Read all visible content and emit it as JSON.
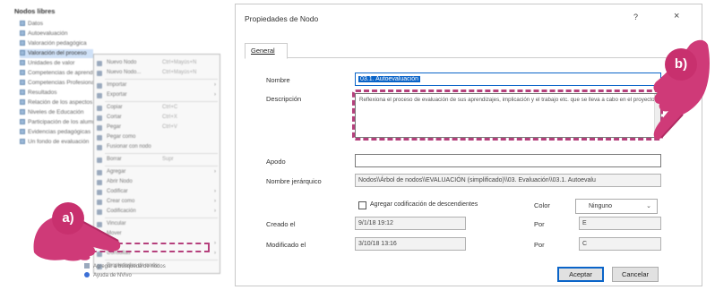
{
  "tree": {
    "title": "Nodos libres",
    "items": [
      {
        "label": "Datos",
        "selected": false
      },
      {
        "label": "Autoevaluación",
        "selected": false
      },
      {
        "label": "Valoración pedagógica",
        "selected": false
      },
      {
        "label": "Valoración del proceso",
        "selected": true
      },
      {
        "label": "Unidades de valor",
        "selected": false
      },
      {
        "label": "Competencias de aprendizaje",
        "selected": false
      },
      {
        "label": "Competencias Profesionales",
        "selected": false
      },
      {
        "label": "Resultados",
        "selected": false
      },
      {
        "label": "Relación de los aspectos",
        "selected": false
      },
      {
        "label": "Niveles de Educación",
        "selected": false
      },
      {
        "label": "Participación de los alumnos",
        "selected": false
      },
      {
        "label": "Evidencias pedagógicas",
        "selected": false
      },
      {
        "label": "Un fondo de evaluación",
        "selected": false
      }
    ]
  },
  "context_menu": {
    "items": [
      {
        "label": "Nuevo Nodo",
        "shortcut": "Ctrl+Mayús+N",
        "arrow": false
      },
      {
        "label": "Nuevo Nodo...",
        "shortcut": "Ctrl+Mayús+N",
        "arrow": false
      },
      {
        "label": "Importar",
        "shortcut": "",
        "arrow": true
      },
      {
        "label": "Exportar",
        "shortcut": "",
        "arrow": true
      },
      {
        "label": "Copiar",
        "shortcut": "Ctrl+C",
        "arrow": false
      },
      {
        "label": "Cortar",
        "shortcut": "Ctrl+X",
        "arrow": false
      },
      {
        "label": "Pegar",
        "shortcut": "Ctrl+V",
        "arrow": false
      },
      {
        "label": "Pegar como",
        "shortcut": "",
        "arrow": false
      },
      {
        "label": "Fusionar con nodo",
        "shortcut": "",
        "arrow": false
      },
      {
        "label": "Borrar",
        "shortcut": "Supr",
        "arrow": false
      },
      {
        "label": "Agregar",
        "shortcut": "",
        "arrow": true
      },
      {
        "label": "Abrir Nodo",
        "shortcut": "",
        "arrow": false
      },
      {
        "label": "Codificar",
        "shortcut": "",
        "arrow": true
      },
      {
        "label": "Crear como",
        "shortcut": "",
        "arrow": true
      },
      {
        "label": "Codificación",
        "shortcut": "",
        "arrow": true
      },
      {
        "label": "Vincular",
        "shortcut": "",
        "arrow": false
      },
      {
        "label": "Mover",
        "shortcut": "",
        "arrow": false
      },
      {
        "label": "Color",
        "shortcut": "",
        "arrow": true
      },
      {
        "label": "Consultas",
        "shortcut": "",
        "arrow": true
      },
      {
        "label": "Propiedades de nodo",
        "shortcut": "",
        "arrow": false
      }
    ],
    "below_items": [
      {
        "label": "Agregar a búsqueda de nodos"
      },
      {
        "label": "Ayuda de NVivo"
      }
    ]
  },
  "dialog": {
    "title": "Propiedades de Nodo",
    "help_glyph": "?",
    "close_glyph": "×",
    "tab": "General",
    "nombre_label": "Nombre",
    "nombre_value": "03.1. Autoevaluación",
    "descripcion_label": "Descripción",
    "descripcion_value": "Reflexiona el proceso de evaluación de sus aprendizajes, implicación y el trabajo etc. que se lleva a cabo en el proyecto",
    "apodo_label": "Apodo",
    "apodo_value": "",
    "jerarquico_label": "Nombre jerárquico",
    "jerarquico_value": "Nodos\\\\Árbol de nodos\\\\EVALUACIÓN (simplificado)\\\\03. Evaluación\\\\03.1. Autoevalu",
    "checkbox_label": "Agregar codificación de descendientes",
    "color_label": "Color",
    "color_value": "Ninguno",
    "creado_label": "Creado el",
    "creado_value": "9/1/18 19:12",
    "creado_por_label": "Por",
    "creado_por_value": "E",
    "modificado_label": "Modificado el",
    "modificado_value": "3/10/18 13:16",
    "modificado_por_label": "Por",
    "modificado_por_value": "C",
    "accept_label": "Aceptar",
    "cancel_label": "Cancelar"
  },
  "annotations": {
    "badge_a": "a)",
    "badge_b": "b)",
    "highlight_color": "#b5407c",
    "badge_color": "#c8306e",
    "hand_color": "#cf3a78"
  }
}
